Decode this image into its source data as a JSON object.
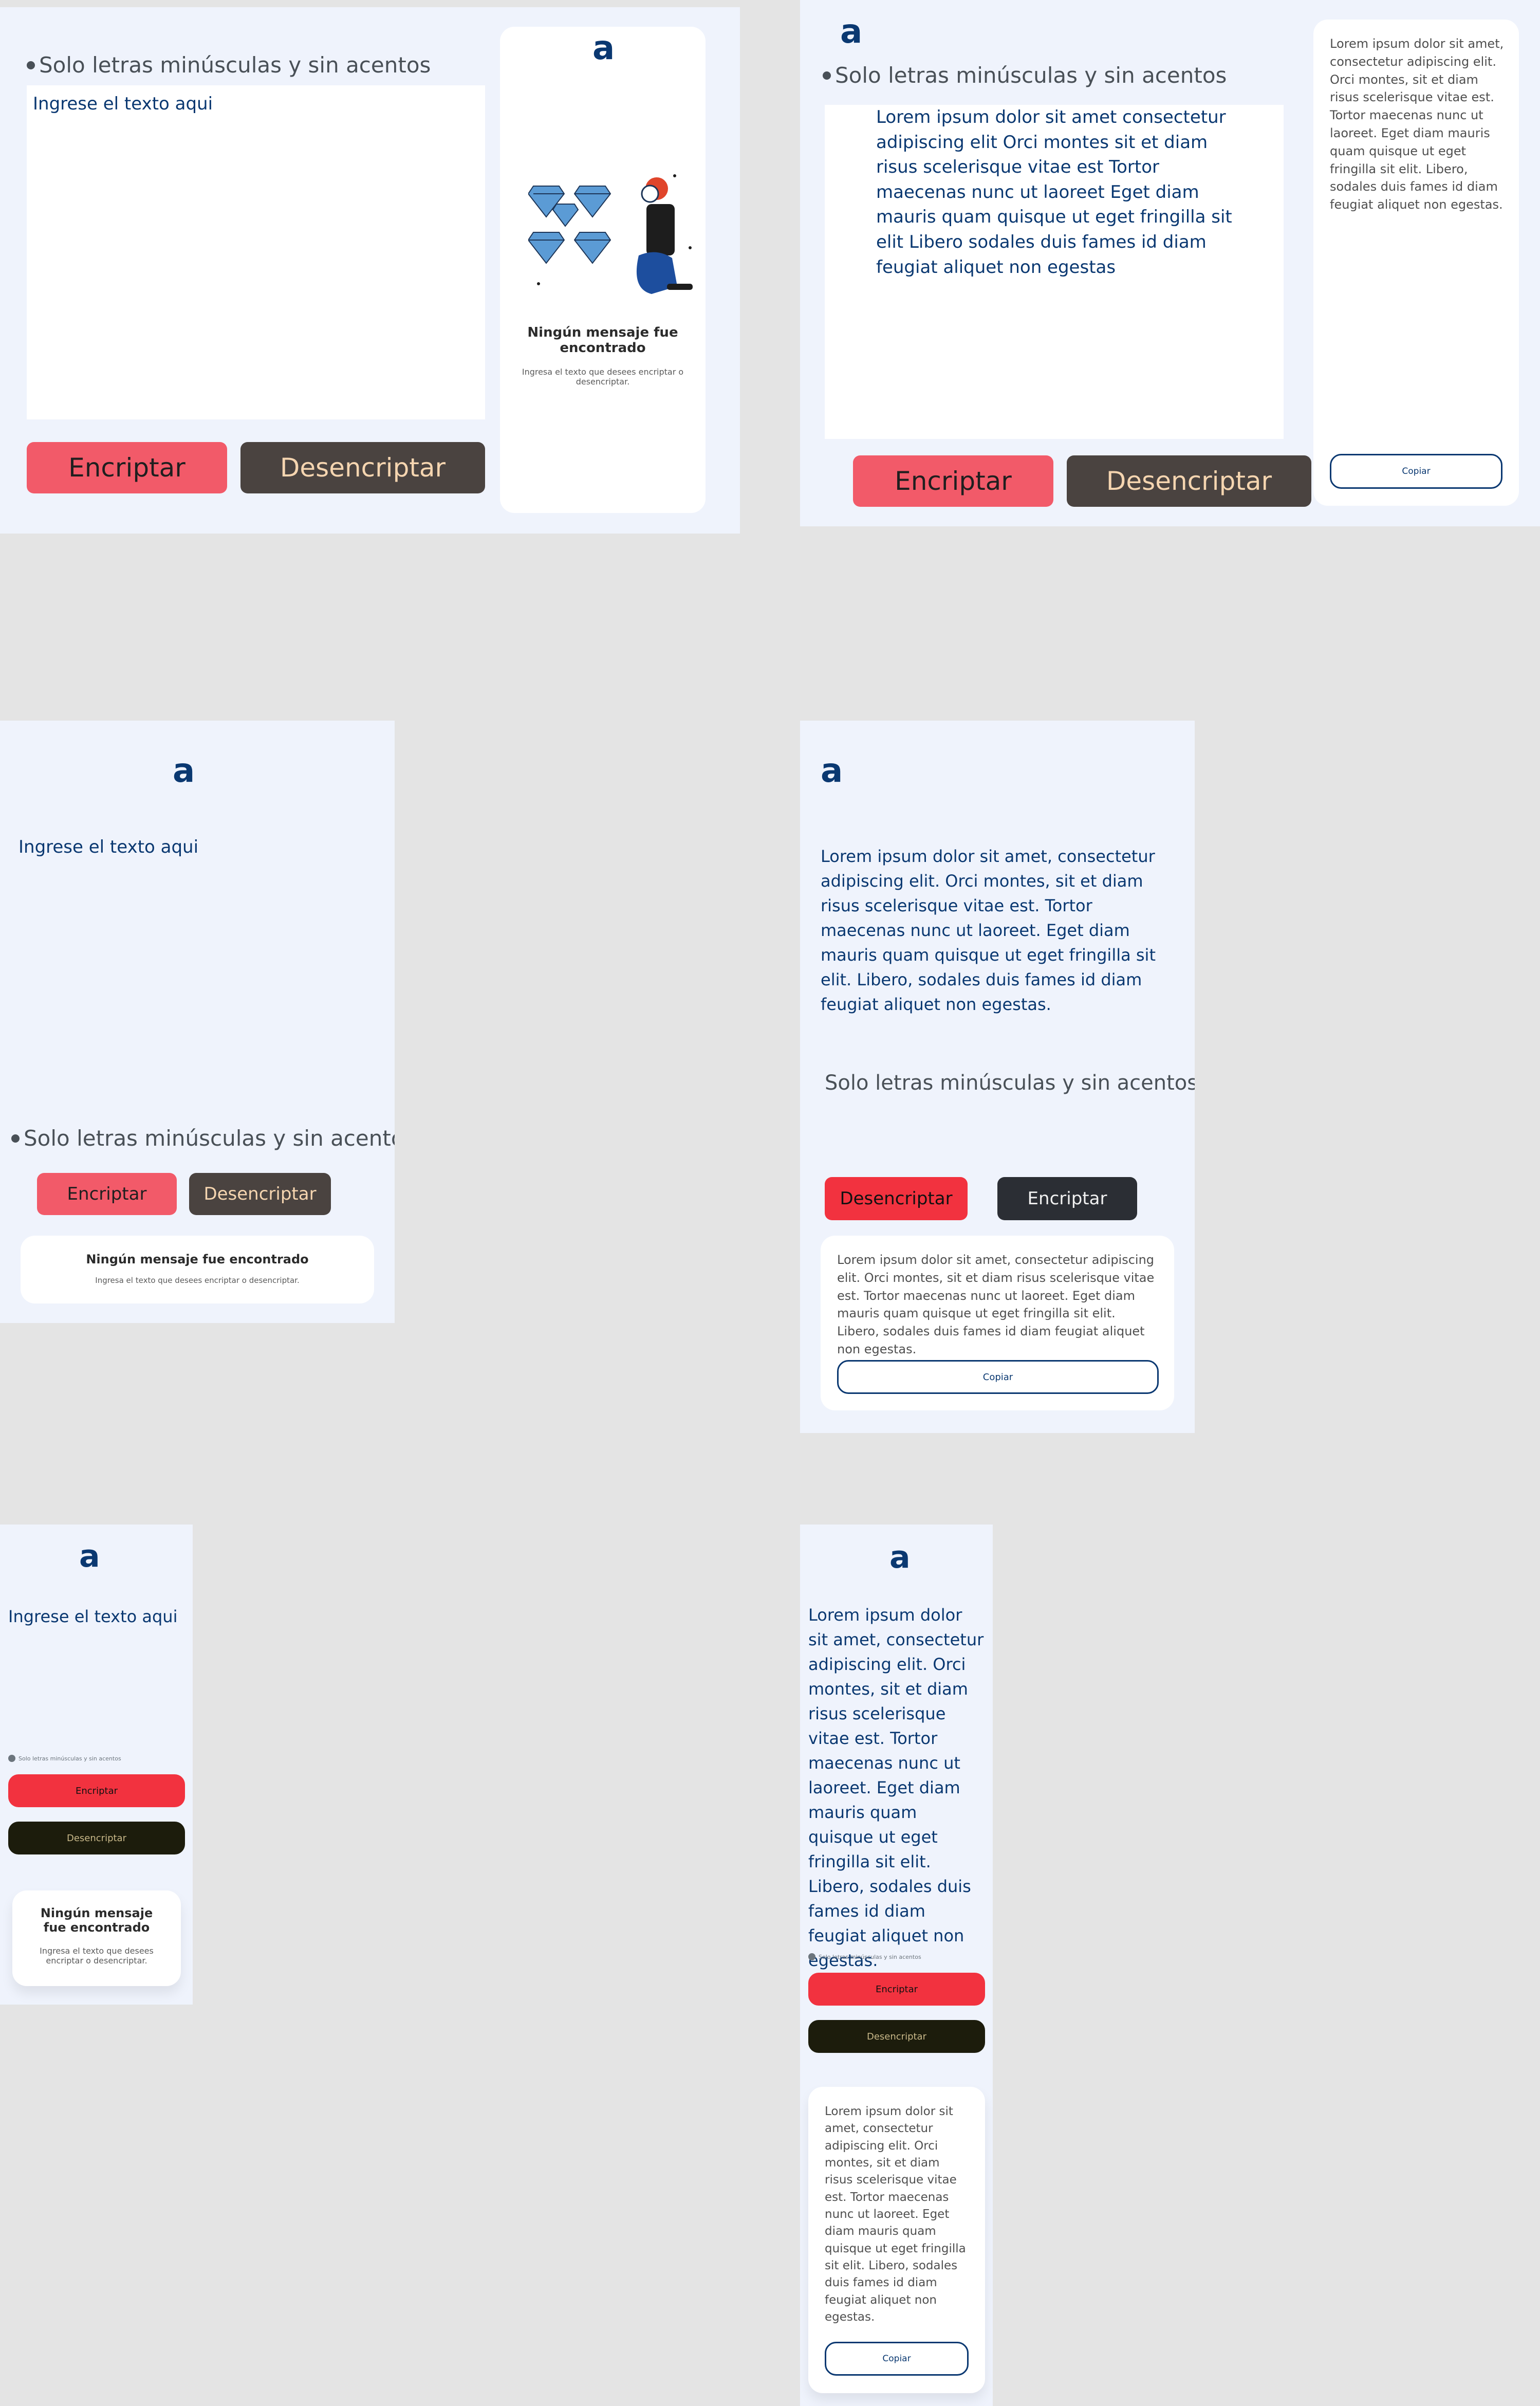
{
  "logo": "a",
  "hint": "Solo letras minúsculas y sin acentos",
  "placeholder": "Ingrese el texto aqui",
  "buttons": {
    "encrypt": "Encriptar",
    "decrypt": "Desencriptar",
    "copy": "Copiar"
  },
  "empty_state": {
    "title": "Ningún mensaje fue encontrado",
    "subtitle": "Ingresa el texto que desees encriptar o desencriptar."
  },
  "input_text_desktop": "Lorem ipsum dolor sit amet consectetur adipiscing elit Orci montes sit et diam risus scelerisque vitae est Tortor maecenas nunc ut laoreet Eget diam mauris quam quisque ut eget fringilla sit elit Libero sodales duis fames id diam feugiat aliquet non egestas",
  "input_text": "Lorem ipsum dolor sit amet, consectetur adipiscing elit. Orci montes, sit et diam risus scelerisque vitae est. Tortor maecenas nunc ut laoreet. Eget diam mauris quam quisque ut eget fringilla sit elit. Libero, sodales duis fames id diam feugiat aliquet non egestas.",
  "result_text": "Lorem ipsum dolor sit amet, consectetur adipiscing elit. Orci montes, sit et diam risus scelerisque vitae est. Tortor maecenas nunc ut laoreet. Eget diam mauris quam quisque ut eget fringilla sit elit. Libero, sodales duis fames id diam feugiat aliquet non egestas.",
  "colors": {
    "background": "#eff3fc",
    "brand": "#0a3871",
    "encrypt_button": "#f25a69",
    "decrypt_button": "#4a4340"
  },
  "icons": [
    "logo-icon",
    "info-icon",
    "diamond-illustration"
  ]
}
